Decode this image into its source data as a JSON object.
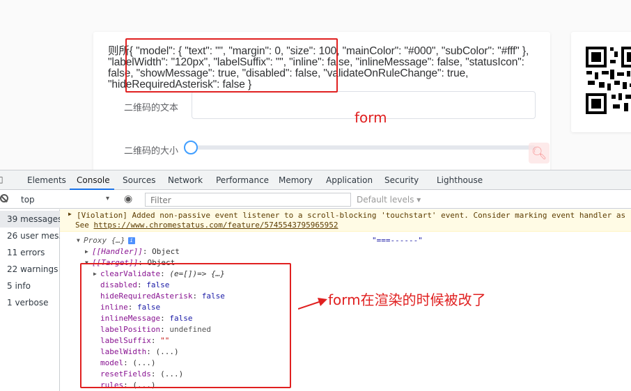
{
  "page": {
    "form_dump": "则所{ \"model\": { \"text\": \"\", \"margin\": 0, \"size\": 100, \"mainColor\": \"#000\", \"subColor\": \"#fff\" }, \"labelWidth\": \"120px\", \"labelSuffix\": \"\", \"inline\": false, \"inlineMessage\": false, \"statusIcon\": false, \"showMessage\": true, \"disabled\": false, \"validateOnRuleChange\": true, \"hideRequiredAsterisk\": false }",
    "label_text": "二维码的文本",
    "label_size": "二维码的大小",
    "text_value": "",
    "annotation_form": "form",
    "annotation_render": "form在渲染的时候被改了",
    "accent_color": "#409eff",
    "annotation_color": "#e02020"
  },
  "devtools": {
    "tabs": [
      "Elements",
      "Console",
      "Sources",
      "Network",
      "Performance",
      "Memory",
      "Application",
      "Security",
      "Lighthouse"
    ],
    "active_tab": "Console",
    "context": "top",
    "filter_placeholder": "Filter",
    "levels": "Default levels ▾",
    "sidebar": [
      "39 messages",
      "26 user mes...",
      "11 errors",
      "22 warnings",
      "5 info",
      "1 verbose"
    ],
    "violation_line1": "[Violation] Added non-passive event listener to a scroll-blocking 'touchstart' event. Consider marking event handler as",
    "violation_see": "See ",
    "violation_link": "https://www.chromestatus.com/feature/5745543795965952",
    "proxy_label": "Proxy {…}",
    "separator_string": "\"===------\"",
    "handler_key": "[[Handler]]",
    "handler_val": "Object",
    "target_key": "[[Target]]",
    "target_val": "Object",
    "props": [
      {
        "key": "clearValidate",
        "val": "(e=[])=> {…}",
        "kind": "fn"
      },
      {
        "key": "disabled",
        "val": "false",
        "kind": "bool"
      },
      {
        "key": "hideRequiredAsterisk",
        "val": "false",
        "kind": "bool"
      },
      {
        "key": "inline",
        "val": "false",
        "kind": "bool"
      },
      {
        "key": "inlineMessage",
        "val": "false",
        "kind": "bool"
      },
      {
        "key": "labelPosition",
        "val": "undefined",
        "kind": "undef"
      },
      {
        "key": "labelSuffix",
        "val": "\"\"",
        "kind": "str"
      },
      {
        "key": "labelWidth",
        "val": "(...)",
        "kind": "getter"
      },
      {
        "key": "model",
        "val": "(...)",
        "kind": "getter"
      },
      {
        "key": "resetFields",
        "val": "(...)",
        "kind": "getter"
      },
      {
        "key": "rules",
        "val": "(...)",
        "kind": "getter"
      }
    ]
  }
}
